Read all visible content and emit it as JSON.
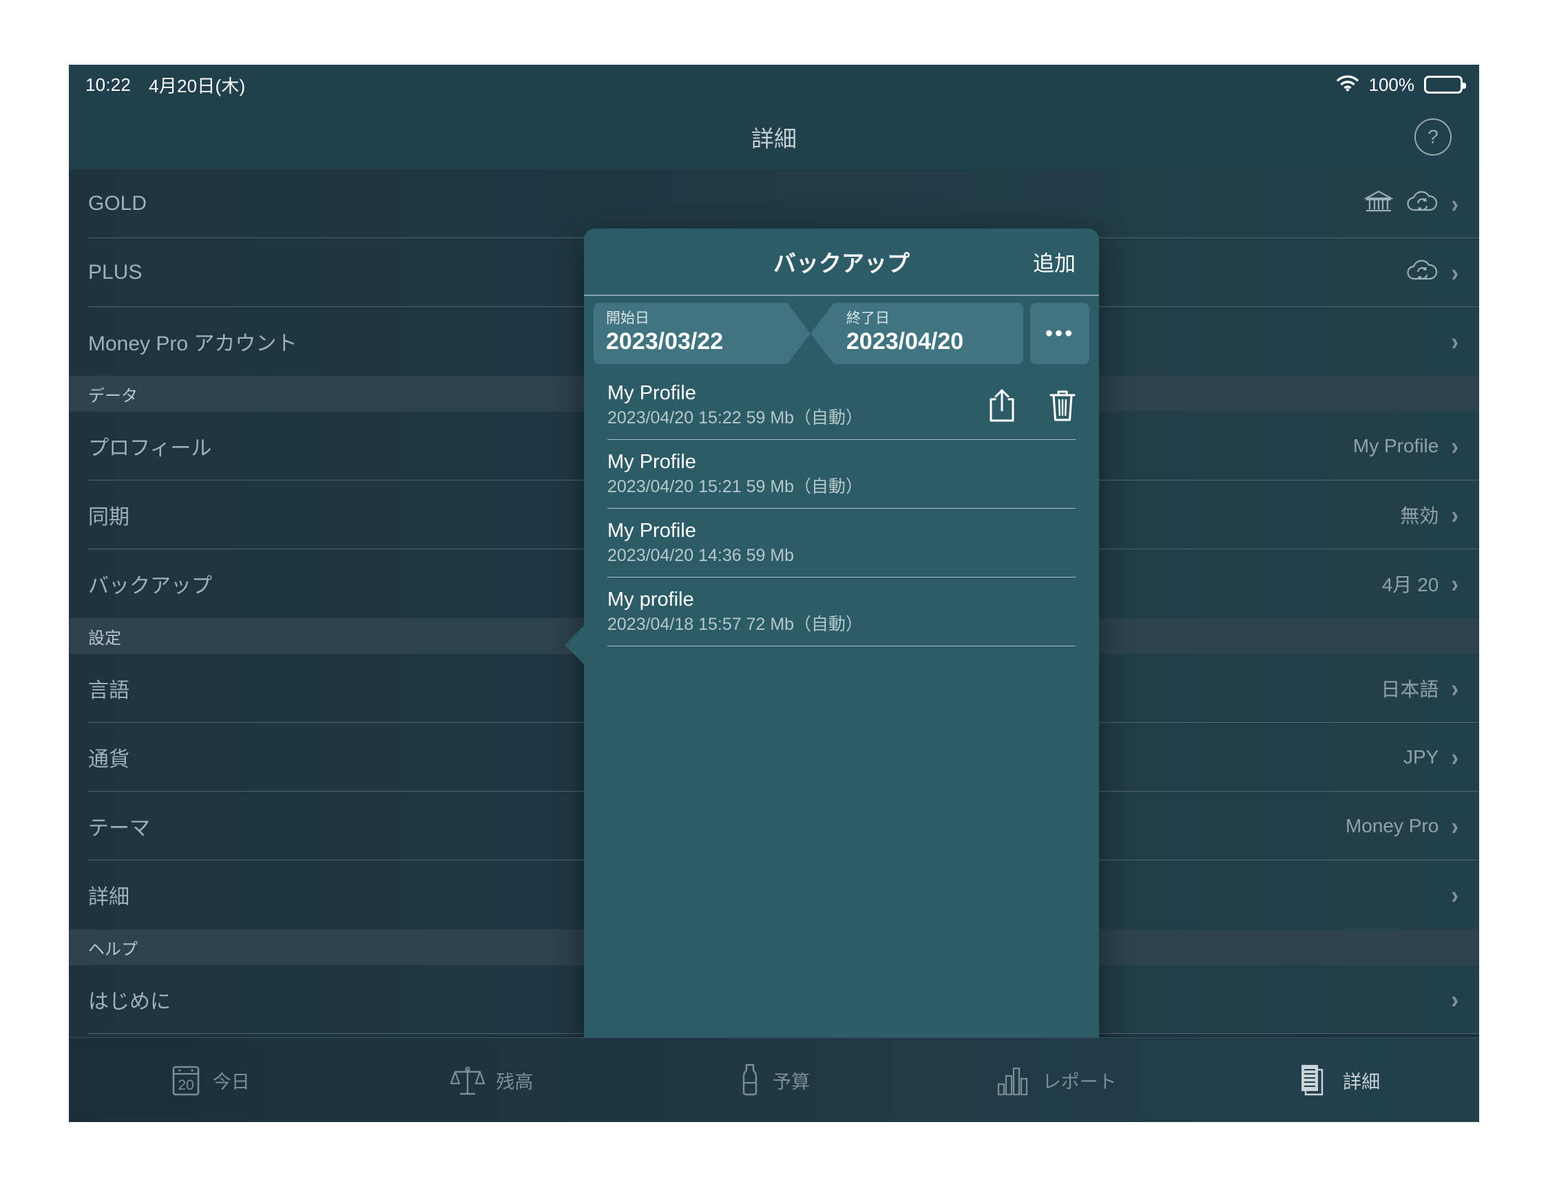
{
  "status_bar": {
    "time": "10:22",
    "date": "4月20日(木)",
    "wifi_icon": "wifi-icon",
    "battery_percent": "100%",
    "battery_icon": "battery-full-icon"
  },
  "navbar": {
    "title": "詳細",
    "help_icon": "question-mark-icon",
    "help_label": "?"
  },
  "list": {
    "rows": [
      {
        "label": "GOLD",
        "value": "",
        "icons": [
          "bank-icon",
          "cloud-sync-icon"
        ],
        "chevron": "›"
      },
      {
        "label": "PLUS",
        "value": "",
        "icons": [
          "cloud-sync-icon"
        ],
        "chevron": "›"
      },
      {
        "label": "Money Pro アカウント",
        "value": "",
        "icons": [],
        "chevron": "›"
      }
    ],
    "section_data": {
      "header": "データ",
      "rows": [
        {
          "label": "プロフィール",
          "value": "My Profile",
          "chevron": "›"
        },
        {
          "label": "同期",
          "value": "無効",
          "chevron": "›"
        },
        {
          "label": "バックアップ",
          "value": "4月 20",
          "chevron": "›"
        }
      ]
    },
    "section_settings": {
      "header": "設定",
      "rows": [
        {
          "label": "言語",
          "value": "日本語",
          "chevron": "›"
        },
        {
          "label": "通貨",
          "value": "JPY",
          "chevron": "›"
        },
        {
          "label": "テーマ",
          "value": "Money Pro",
          "chevron": "›"
        },
        {
          "label": "詳細",
          "value": "",
          "chevron": "›"
        }
      ]
    },
    "section_help": {
      "header": "ヘルプ",
      "rows": [
        {
          "label": "はじめに",
          "value": "",
          "chevron": "›"
        }
      ]
    }
  },
  "popover": {
    "title": "バックアップ",
    "add_label": "追加",
    "more_label": "•••",
    "range": {
      "start_caption": "開始日",
      "start_value": "2023/03/22",
      "end_caption": "終了日",
      "end_value": "2023/04/20"
    },
    "items": [
      {
        "name": "My Profile",
        "meta": "2023/04/20 15:22 59 Mb（自動）",
        "selected": true,
        "share_icon": "share-icon",
        "delete_icon": "trash-icon"
      },
      {
        "name": "My Profile",
        "meta": "2023/04/20 15:21 59 Mb（自動）",
        "selected": false
      },
      {
        "name": "My Profile",
        "meta": "2023/04/20 14:36 59 Mb",
        "selected": false
      },
      {
        "name": "My profile",
        "meta": "2023/04/18 15:57 72 Mb（自動）",
        "selected": false
      }
    ]
  },
  "tabbar": {
    "tabs": [
      {
        "label": "今日",
        "icon": "calendar-20-icon",
        "active": false
      },
      {
        "label": "残高",
        "icon": "scales-icon",
        "active": false
      },
      {
        "label": "予算",
        "icon": "budget-bottle-icon",
        "active": false
      },
      {
        "label": "レポート",
        "icon": "bar-chart-icon",
        "active": false
      },
      {
        "label": "詳細",
        "icon": "document-icon",
        "active": true
      }
    ]
  },
  "colors": {
    "app_background": "#1e3340",
    "navbar": "#21404d",
    "popover": "#2c5c67",
    "range_segment": "#3f7480",
    "text_primary": "#ffffff",
    "text_secondary": "#9fb0b7"
  }
}
